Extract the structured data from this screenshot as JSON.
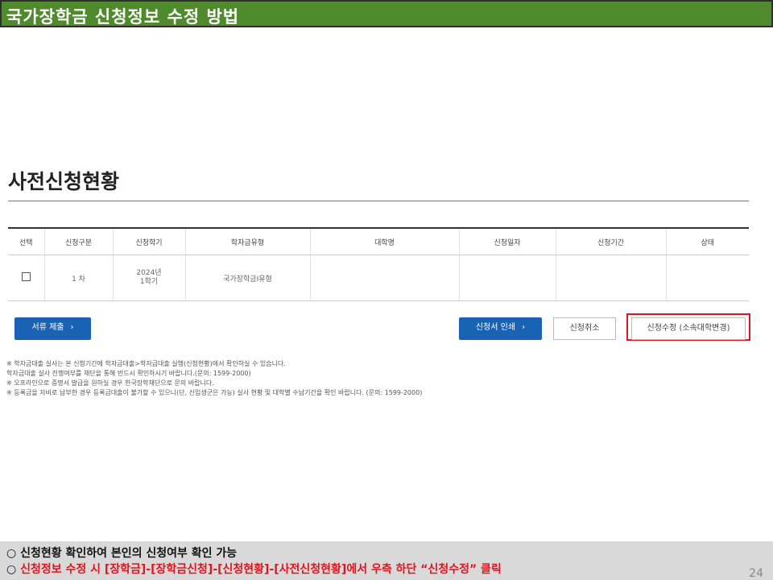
{
  "slide": {
    "title": "국가장학금 신청정보 수정 방법",
    "page_number": "24"
  },
  "section": {
    "title": "사전신청현황"
  },
  "table": {
    "headers": [
      "선택",
      "신청구분",
      "신청학기",
      "학자금유형",
      "대학명",
      "신청일자",
      "신청기간",
      "상태"
    ],
    "row": {
      "type": "1 차",
      "term": "2024년\n1학기",
      "scholarship_type": "국가장학금I유형",
      "university": "",
      "date": "",
      "period": "",
      "status": ""
    }
  },
  "buttons": {
    "submit_docs": "서류 제출",
    "print_application": "신청서 인쇄",
    "cancel_application": "신청취소",
    "modify_application": "신청수정 (소속대학변경)"
  },
  "notes": [
    "※ 학자금대출 실사는 본 신청기간에 학자금대출>학자금대출 실행(신청현황)에서 확인하실 수 있습니다.",
    "   학자금대출 실사 진행여부를 재단을 통해 반드시 확인하시기 바랍니다.(문의: 1599-2000)",
    "※ 오프라인으로 증명서 발급을 원하실 경우 한국장학재단으로 문의 바랍니다.",
    "※ 등록금을 자비로 납부한 경우 등록금대출이 불가할 수 있으니(단, 신입생군은 가능) 실사 현황 및 대학별 수납기간을 확인 바랍니다. (문의: 1599-2000)"
  ],
  "footer": {
    "line1": "○ 신청현황 확인하여 본인의 신청여부 확인 가능",
    "line2_prefix": "○ ",
    "line2_red": "신청정보 수정 시 [장학금]-[장학금신청]-[신청현황]-[사전신청현황]에서 우측 하단 “신청수정” 클릭"
  },
  "colors": {
    "title_bar": "#4f8a2c",
    "button_blue": "#1a63b4",
    "highlight_red": "#e0141e"
  }
}
